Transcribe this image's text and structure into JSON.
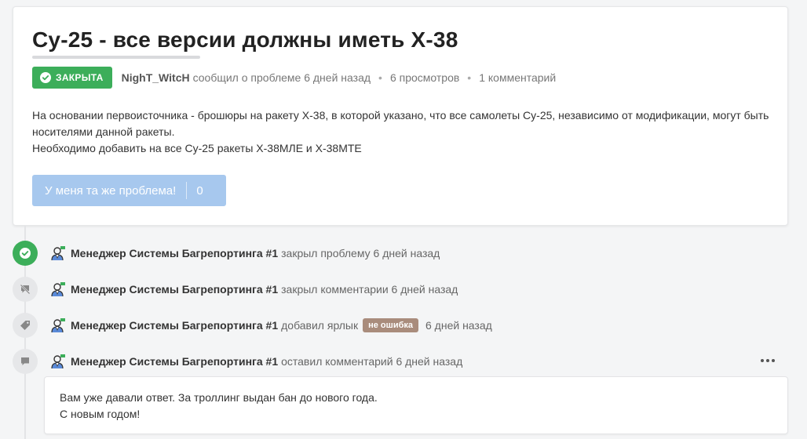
{
  "issue": {
    "title": "Су-25 - все версии должны иметь Х-38",
    "status_badge": "ЗАКРЫТА",
    "author": "NighT_WitcH",
    "reported_text": "сообщил о проблеме 6 дней назад",
    "views": "6 просмотров",
    "comments": "1 комментарий",
    "description": [
      "На основании первоисточника - брошюры на ракету Х-38, в которой указано, что все самолеты Су-25, независимо от модификации, могут быть носителями данной ракеты.",
      "Необходимо добавить на все Су-25 ракеты Х-38МЛЕ и Х-38МТЕ"
    ],
    "same_problem_label": "У меня та же проблема!",
    "same_problem_count": "0"
  },
  "colors": {
    "closed_badge": "#3cae5a",
    "same_button": "#a7c8ee",
    "label_tag": "#a98c7c"
  },
  "timeline": [
    {
      "icon": "check-icon",
      "user": "Менеджер Системы Багрепортинга #1",
      "text": "закрыл проблему 6 дней назад"
    },
    {
      "icon": "comments-locked-icon",
      "user": "Менеджер Системы Багрепортинга #1",
      "text": "закрыл комментарии 6 дней назад"
    },
    {
      "icon": "tag-icon",
      "user": "Менеджер Системы Багрепортинга #1",
      "text": "добавил ярлык",
      "label": "не ошибка",
      "time": "6 дней назад"
    },
    {
      "icon": "comment-icon",
      "user": "Менеджер Системы Багрепортинга #1",
      "text": "оставил комментарий 6 дней назад"
    }
  ],
  "comment": {
    "lines": [
      "Вам уже давали ответ. За троллинг выдан бан до нового года.",
      "С новым годом!"
    ]
  }
}
